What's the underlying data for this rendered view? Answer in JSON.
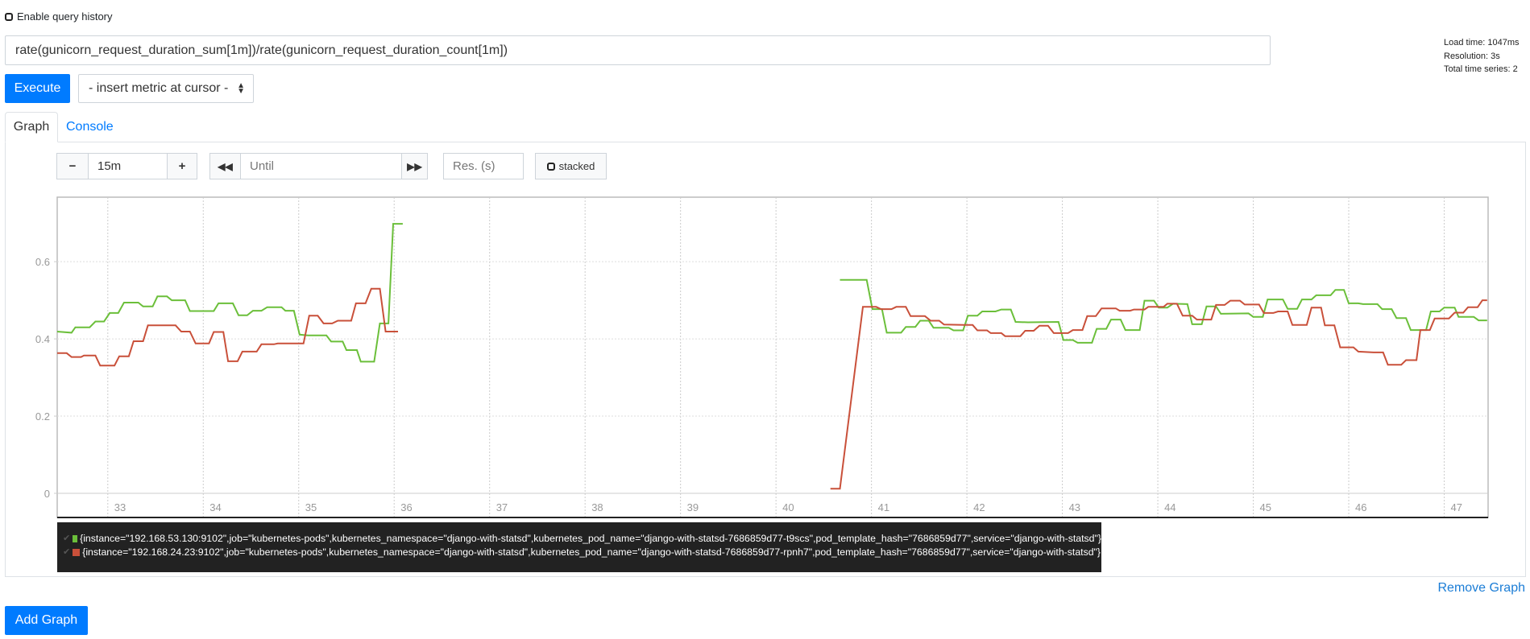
{
  "history": {
    "label": "Enable query history",
    "checked": false
  },
  "query": {
    "value": "rate(gunicorn_request_duration_sum[1m])/rate(gunicorn_request_duration_count[1m])"
  },
  "stats": {
    "load_time": "Load time: 1047ms",
    "resolution": "Resolution: 3s",
    "total_series": "Total time series: 2"
  },
  "toolbar": {
    "execute_label": "Execute",
    "metric_select": "- insert metric at cursor -"
  },
  "tabs": [
    {
      "label": "Graph",
      "active": true
    },
    {
      "label": "Console",
      "active": false
    }
  ],
  "controls": {
    "minus": "−",
    "range": "15m",
    "plus": "+",
    "rewind_icon": "double-left-arrow",
    "until_placeholder": "Until",
    "forward_icon": "double-right-arrow",
    "res_placeholder": "Res. (s)",
    "stacked_label": "stacked"
  },
  "legend": [
    {
      "label": "{instance=\"192.168.53.130:9102\",job=\"kubernetes-pods\",kubernetes_namespace=\"django-with-statsd\",kubernetes_pod_name=\"django-with-statsd-7686859d77-t9scs\",pod_template_hash=\"7686859d77\",service=\"django-with-statsd\"}",
      "color": "#6bbf3a"
    },
    {
      "label": "{instance=\"192.168.24.23:9102\",job=\"kubernetes-pods\",kubernetes_namespace=\"django-with-statsd\",kubernetes_pod_name=\"django-with-statsd-7686859d77-rpnh7\",pod_template_hash=\"7686859d77\",service=\"django-with-statsd\"}",
      "color": "#c9503a"
    }
  ],
  "remove_graph": "Remove Graph",
  "add_graph": "Add Graph",
  "chart_data": {
    "type": "line",
    "xlim": [
      32.47,
      47.46
    ],
    "ylim": [
      -0.0625,
      0.767
    ],
    "x_ticks": [
      "33",
      "34",
      "35",
      "36",
      "37",
      "38",
      "39",
      "40",
      "41",
      "42",
      "43",
      "44",
      "45",
      "46",
      "47"
    ],
    "y_ticks": [
      "0",
      "0.2",
      "0.4",
      "0.6"
    ],
    "grid": true,
    "series": [
      {
        "color": "#6bbf3a",
        "segments": [
          [
            [
              32.47,
              0.419
            ],
            [
              32.62,
              0.416
            ],
            [
              32.66,
              0.43
            ],
            [
              32.81,
              0.43
            ],
            [
              32.87,
              0.445
            ],
            [
              32.96,
              0.445
            ],
            [
              33.02,
              0.467
            ],
            [
              33.11,
              0.467
            ],
            [
              33.17,
              0.494
            ],
            [
              33.32,
              0.494
            ],
            [
              33.37,
              0.484
            ],
            [
              33.47,
              0.484
            ],
            [
              33.52,
              0.51
            ],
            [
              33.62,
              0.51
            ],
            [
              33.67,
              0.5
            ],
            [
              33.81,
              0.5
            ],
            [
              33.86,
              0.472
            ],
            [
              34.11,
              0.472
            ],
            [
              34.16,
              0.492
            ],
            [
              34.31,
              0.492
            ],
            [
              34.37,
              0.461
            ],
            [
              34.46,
              0.461
            ],
            [
              34.52,
              0.473
            ],
            [
              34.61,
              0.473
            ],
            [
              34.67,
              0.482
            ],
            [
              34.82,
              0.482
            ],
            [
              34.86,
              0.473
            ],
            [
              34.95,
              0.473
            ],
            [
              35.01,
              0.411
            ],
            [
              35.1,
              0.409
            ],
            [
              35.29,
              0.409
            ],
            [
              35.34,
              0.393
            ],
            [
              35.46,
              0.393
            ],
            [
              35.5,
              0.371
            ],
            [
              35.61,
              0.371
            ],
            [
              35.65,
              0.341
            ],
            [
              35.79,
              0.341
            ],
            [
              35.85,
              0.44
            ],
            [
              35.94,
              0.44
            ],
            [
              35.99,
              0.698
            ],
            [
              36.09,
              0.698
            ]
          ],
          [
            [
              40.67,
              0.553
            ],
            [
              40.95,
              0.553
            ],
            [
              41.01,
              0.477
            ],
            [
              41.11,
              0.477
            ],
            [
              41.16,
              0.416
            ],
            [
              41.31,
              0.416
            ],
            [
              41.36,
              0.431
            ],
            [
              41.46,
              0.431
            ],
            [
              41.51,
              0.447
            ],
            [
              41.6,
              0.447
            ],
            [
              41.65,
              0.429
            ],
            [
              41.81,
              0.429
            ],
            [
              41.86,
              0.422
            ],
            [
              41.96,
              0.422
            ],
            [
              42.01,
              0.46
            ],
            [
              42.11,
              0.46
            ],
            [
              42.16,
              0.471
            ],
            [
              42.3,
              0.471
            ],
            [
              42.36,
              0.476
            ],
            [
              42.46,
              0.476
            ],
            [
              42.51,
              0.444
            ],
            [
              42.64,
              0.443
            ],
            [
              42.96,
              0.444
            ],
            [
              43.01,
              0.397
            ],
            [
              43.11,
              0.397
            ],
            [
              43.16,
              0.39
            ],
            [
              43.31,
              0.39
            ],
            [
              43.36,
              0.426
            ],
            [
              43.46,
              0.426
            ],
            [
              43.51,
              0.45
            ],
            [
              43.61,
              0.45
            ],
            [
              43.66,
              0.423
            ],
            [
              43.81,
              0.423
            ],
            [
              43.86,
              0.499
            ],
            [
              43.96,
              0.499
            ],
            [
              44.01,
              0.481
            ],
            [
              44.1,
              0.481
            ],
            [
              44.16,
              0.491
            ],
            [
              44.31,
              0.49
            ],
            [
              44.36,
              0.438
            ],
            [
              44.46,
              0.438
            ],
            [
              44.51,
              0.484
            ],
            [
              44.61,
              0.484
            ],
            [
              44.66,
              0.465
            ],
            [
              44.95,
              0.466
            ],
            [
              45.0,
              0.457
            ],
            [
              45.1,
              0.457
            ],
            [
              45.15,
              0.502
            ],
            [
              45.31,
              0.502
            ],
            [
              45.36,
              0.478
            ],
            [
              45.46,
              0.478
            ],
            [
              45.51,
              0.502
            ],
            [
              45.61,
              0.502
            ],
            [
              45.66,
              0.513
            ],
            [
              45.81,
              0.513
            ],
            [
              45.86,
              0.527
            ],
            [
              45.95,
              0.527
            ],
            [
              46.0,
              0.492
            ],
            [
              46.1,
              0.492
            ],
            [
              46.15,
              0.49
            ],
            [
              46.3,
              0.49
            ],
            [
              46.35,
              0.477
            ],
            [
              46.45,
              0.477
            ],
            [
              46.5,
              0.454
            ],
            [
              46.6,
              0.454
            ],
            [
              46.65,
              0.423
            ],
            [
              46.81,
              0.423
            ],
            [
              46.86,
              0.471
            ],
            [
              46.95,
              0.471
            ],
            [
              47.0,
              0.481
            ],
            [
              47.11,
              0.481
            ],
            [
              47.15,
              0.457
            ],
            [
              47.31,
              0.457
            ],
            [
              47.36,
              0.448
            ],
            [
              47.45,
              0.448
            ]
          ]
        ]
      },
      {
        "color": "#c9503a",
        "segments": [
          [
            [
              32.47,
              0.363
            ],
            [
              32.57,
              0.363
            ],
            [
              32.62,
              0.353
            ],
            [
              32.72,
              0.353
            ],
            [
              32.75,
              0.357
            ],
            [
              32.87,
              0.357
            ],
            [
              32.92,
              0.331
            ],
            [
              33.07,
              0.331
            ],
            [
              33.12,
              0.355
            ],
            [
              33.22,
              0.355
            ],
            [
              33.27,
              0.394
            ],
            [
              33.37,
              0.394
            ],
            [
              33.42,
              0.435
            ],
            [
              33.71,
              0.435
            ],
            [
              33.77,
              0.419
            ],
            [
              33.86,
              0.419
            ],
            [
              33.92,
              0.388
            ],
            [
              34.06,
              0.388
            ],
            [
              34.11,
              0.418
            ],
            [
              34.21,
              0.418
            ],
            [
              34.26,
              0.342
            ],
            [
              34.36,
              0.342
            ],
            [
              34.41,
              0.367
            ],
            [
              34.56,
              0.367
            ],
            [
              34.61,
              0.386
            ],
            [
              34.74,
              0.386
            ],
            [
              34.78,
              0.388
            ],
            [
              35.05,
              0.388
            ],
            [
              35.11,
              0.46
            ],
            [
              35.2,
              0.46
            ],
            [
              35.26,
              0.44
            ],
            [
              35.35,
              0.44
            ],
            [
              35.41,
              0.447
            ],
            [
              35.55,
              0.447
            ],
            [
              35.6,
              0.492
            ],
            [
              35.7,
              0.492
            ],
            [
              35.76,
              0.53
            ],
            [
              35.85,
              0.53
            ],
            [
              35.91,
              0.419
            ],
            [
              36.04,
              0.419
            ]
          ],
          [
            [
              40.57,
              0.012
            ],
            [
              40.67,
              0.012
            ],
            [
              40.91,
              0.483
            ],
            [
              41.05,
              0.483
            ],
            [
              41.1,
              0.477
            ],
            [
              41.21,
              0.477
            ],
            [
              41.26,
              0.483
            ],
            [
              41.36,
              0.483
            ],
            [
              41.41,
              0.459
            ],
            [
              41.56,
              0.459
            ],
            [
              41.62,
              0.447
            ],
            [
              41.71,
              0.447
            ],
            [
              41.76,
              0.437
            ],
            [
              41.97,
              0.436
            ],
            [
              42.06,
              0.436
            ],
            [
              42.11,
              0.422
            ],
            [
              42.21,
              0.422
            ],
            [
              42.25,
              0.415
            ],
            [
              42.36,
              0.415
            ],
            [
              42.4,
              0.407
            ],
            [
              42.56,
              0.407
            ],
            [
              42.61,
              0.421
            ],
            [
              42.7,
              0.421
            ],
            [
              42.76,
              0.434
            ],
            [
              42.85,
              0.434
            ],
            [
              42.91,
              0.415
            ],
            [
              43.06,
              0.415
            ],
            [
              43.11,
              0.423
            ],
            [
              43.21,
              0.423
            ],
            [
              43.26,
              0.459
            ],
            [
              43.35,
              0.459
            ],
            [
              43.41,
              0.479
            ],
            [
              43.56,
              0.479
            ],
            [
              43.6,
              0.473
            ],
            [
              43.71,
              0.473
            ],
            [
              43.75,
              0.476
            ],
            [
              43.86,
              0.476
            ],
            [
              43.9,
              0.483
            ],
            [
              44.06,
              0.483
            ],
            [
              44.1,
              0.491
            ],
            [
              44.2,
              0.491
            ],
            [
              44.26,
              0.46
            ],
            [
              44.36,
              0.46
            ],
            [
              44.41,
              0.45
            ],
            [
              44.56,
              0.45
            ],
            [
              44.61,
              0.488
            ],
            [
              44.7,
              0.488
            ],
            [
              44.76,
              0.499
            ],
            [
              44.86,
              0.499
            ],
            [
              44.91,
              0.489
            ],
            [
              45.06,
              0.489
            ],
            [
              45.11,
              0.467
            ],
            [
              45.21,
              0.467
            ],
            [
              45.26,
              0.471
            ],
            [
              45.36,
              0.471
            ],
            [
              45.41,
              0.436
            ],
            [
              45.56,
              0.436
            ],
            [
              45.61,
              0.481
            ],
            [
              45.71,
              0.481
            ],
            [
              45.75,
              0.435
            ],
            [
              45.85,
              0.435
            ],
            [
              45.91,
              0.378
            ],
            [
              46.05,
              0.378
            ],
            [
              46.1,
              0.367
            ],
            [
              46.26,
              0.365
            ],
            [
              46.36,
              0.365
            ],
            [
              46.41,
              0.333
            ],
            [
              46.55,
              0.333
            ],
            [
              46.6,
              0.345
            ],
            [
              46.71,
              0.345
            ],
            [
              46.75,
              0.423
            ],
            [
              46.85,
              0.423
            ],
            [
              46.9,
              0.453
            ],
            [
              47.05,
              0.453
            ],
            [
              47.11,
              0.468
            ],
            [
              47.2,
              0.468
            ],
            [
              47.25,
              0.482
            ],
            [
              47.35,
              0.482
            ],
            [
              47.4,
              0.5
            ],
            [
              47.45,
              0.5
            ]
          ]
        ]
      }
    ]
  }
}
